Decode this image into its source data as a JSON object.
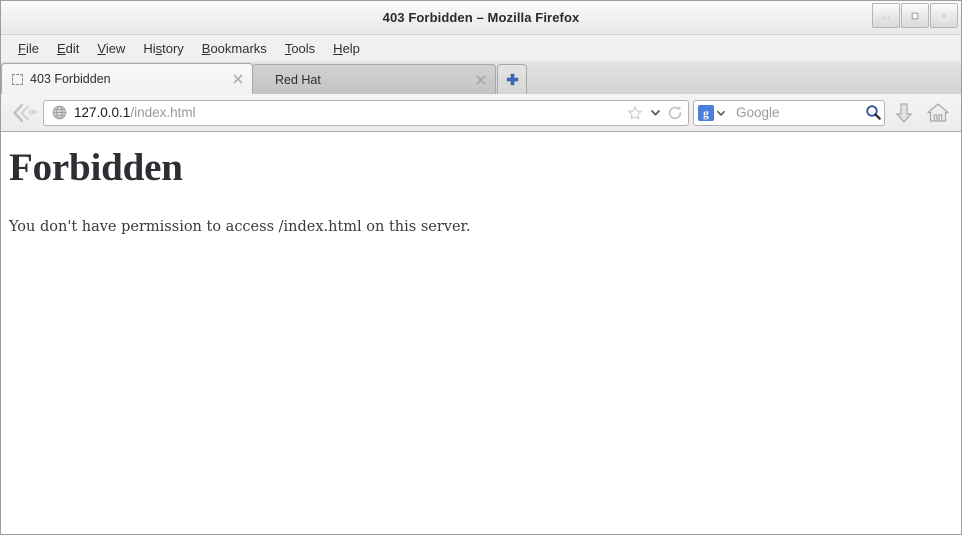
{
  "window": {
    "title": "403 Forbidden – Mozilla Firefox",
    "minimize_label": "Minimize",
    "maximize_label": "Maximize",
    "close_label": "Close"
  },
  "menubar": {
    "items": [
      {
        "label": "File",
        "pre": "",
        "key": "F",
        "post": "ile"
      },
      {
        "label": "Edit",
        "pre": "",
        "key": "E",
        "post": "dit"
      },
      {
        "label": "View",
        "pre": "",
        "key": "V",
        "post": "iew"
      },
      {
        "label": "History",
        "pre": "Hi",
        "key": "s",
        "post": "tory"
      },
      {
        "label": "Bookmarks",
        "pre": "",
        "key": "B",
        "post": "ookmarks"
      },
      {
        "label": "Tools",
        "pre": "",
        "key": "T",
        "post": "ools"
      },
      {
        "label": "Help",
        "pre": "",
        "key": "H",
        "post": "elp"
      }
    ]
  },
  "tabs": {
    "items": [
      {
        "label": "403 Forbidden",
        "active": true,
        "favicon": "dotted-placeholder-icon"
      },
      {
        "label": "Red Hat",
        "active": false,
        "favicon": "none"
      }
    ],
    "new_tab_label": "+"
  },
  "toolbar": {
    "back_forward_label": "Back",
    "url": {
      "host": "127.0.0.1",
      "path": "/index.html",
      "full": "127.0.0.1/index.html"
    },
    "bookmark_label": "Bookmark this page",
    "reload_label": "Reload",
    "download_label": "Downloads",
    "home_label": "Home"
  },
  "search": {
    "engine": "Google",
    "engine_glyph": "g",
    "placeholder": "Google",
    "go_label": "Search"
  },
  "page": {
    "heading": "Forbidden",
    "body": "You don't have permission to access /index.html on this server."
  },
  "colors": {
    "accent_blue": "#4a7ddc",
    "chrome_grey": "#ececec",
    "tab_active": "#f5f5f5",
    "tab_inactive": "#cbcbcb"
  }
}
